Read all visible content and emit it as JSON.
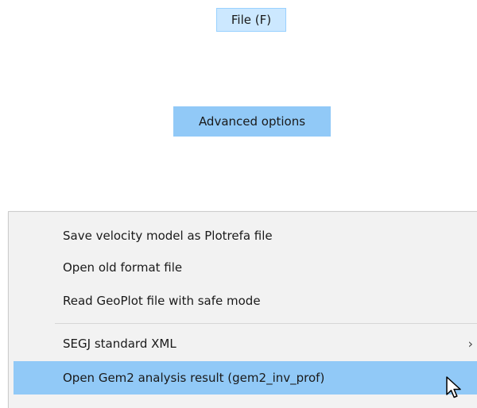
{
  "menubar": {
    "file_label": "File (F)"
  },
  "file_menu": {
    "advanced_label": "Advanced options"
  },
  "advanced_submenu": {
    "items": [
      {
        "label": "Save velocity model as Plotrefa file"
      },
      {
        "label": "Open old format file"
      },
      {
        "label": "Read GeoPlot file with safe mode"
      },
      {
        "label": "SEGJ standard XML",
        "has_submenu": true,
        "chevron": "›"
      },
      {
        "label": "Open Gem2 analysis result (gem2_inv_prof)",
        "highlighted": true
      }
    ]
  },
  "cursor": {
    "icon": "mouse-pointer-icon"
  },
  "colors": {
    "menubar_highlight": "#cce8ff",
    "menubar_highlight_border": "#99d1ff",
    "selected_item": "#91c9f7",
    "submenu_background": "#f2f2f2"
  }
}
